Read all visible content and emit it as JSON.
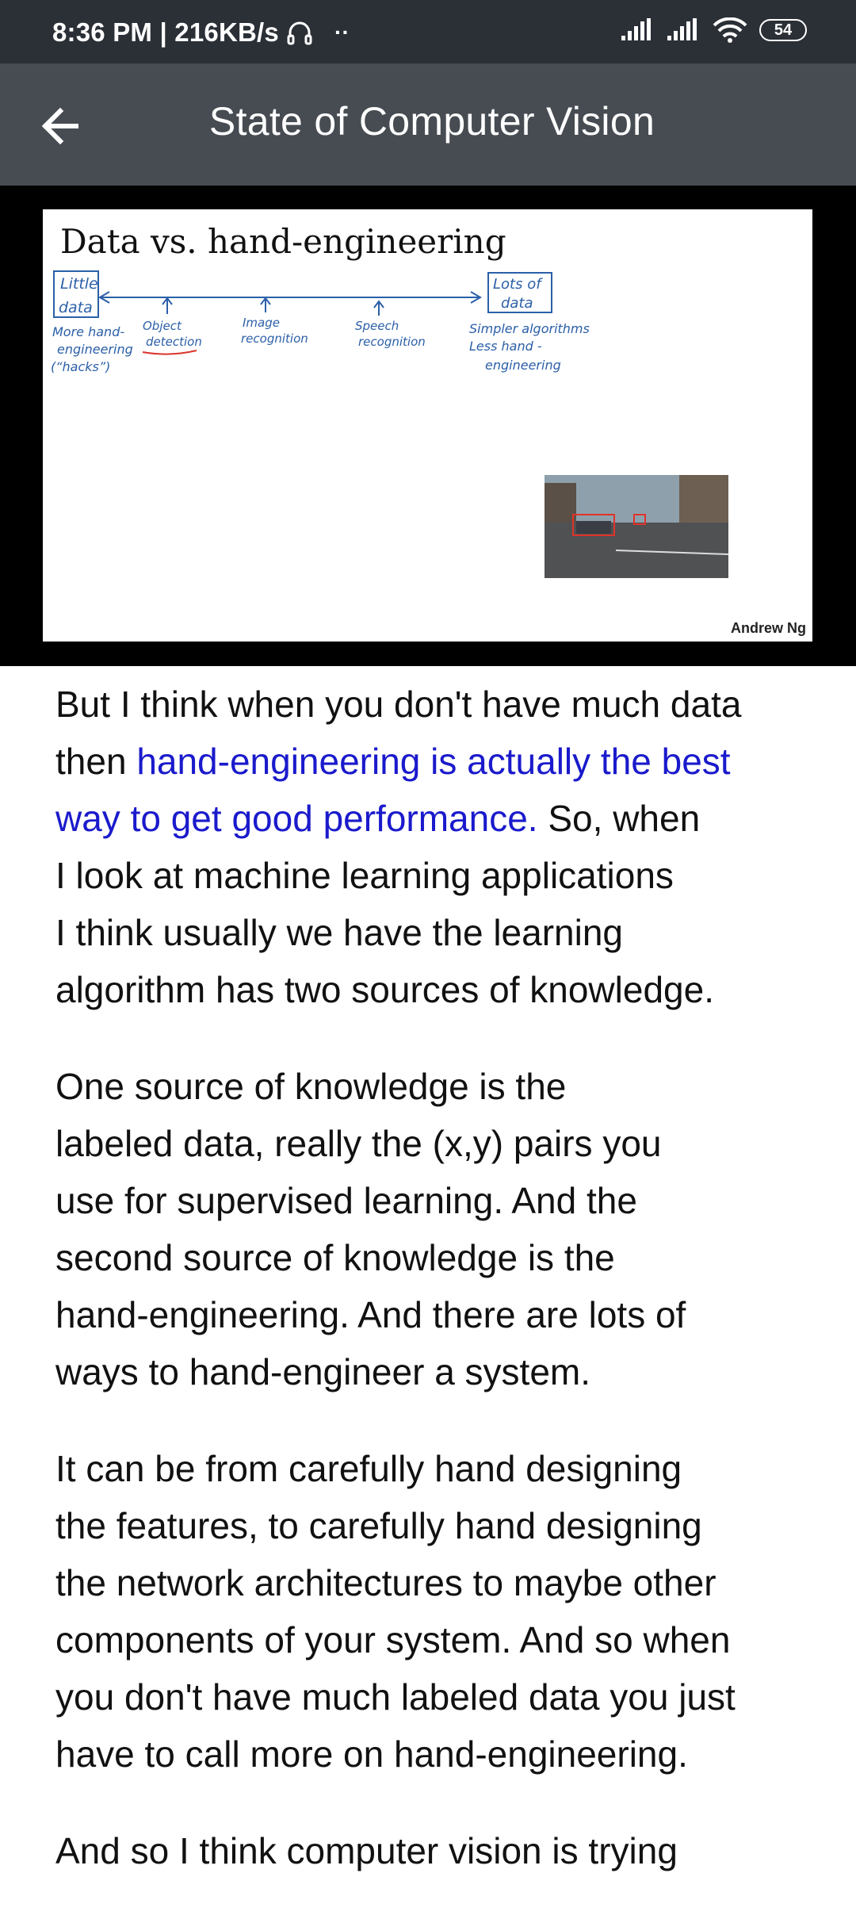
{
  "status": {
    "time_speed": "8:36 PM | 216KB/s",
    "battery": "54"
  },
  "app_bar": {
    "title": "State of Computer Vision"
  },
  "slide": {
    "title": "Data vs. hand-engineering",
    "left_box": [
      "Little",
      "data"
    ],
    "left_notes": [
      "More hand-",
      "engineering",
      "(“hacks”)"
    ],
    "right_box": [
      "Lots of",
      "data"
    ],
    "right_notes": [
      "Simpler algorithms",
      "Less hand -",
      "engineering"
    ],
    "markers": [
      [
        "Object",
        "detection"
      ],
      [
        "Image",
        "recognition"
      ],
      [
        "Speech",
        "recognition"
      ]
    ],
    "credit": "Andrew Ng"
  },
  "transcript": {
    "p1_pre": "But I think when you don't have much data then ",
    "p1_highlight": "hand-engineering is actually the best way to get good performance.",
    "p1_post": " So, when I look at machine learning applications I think usually we have the learning algorithm has two sources of knowledge.",
    "p1_l1": "But I think when you don't have much data",
    "p1_l2a": "then ",
    "p1_l2b": "hand-engineering is actually the best",
    "p1_l3a": "way to get good performance.",
    "p1_l3b": " So, when",
    "p1_l4": "I look at machine learning applications",
    "p1_l5": "I think usually we have the learning",
    "p1_l6": "algorithm has two sources of knowledge.",
    "p2_l1": "One source of knowledge is the",
    "p2_l2": "labeled data, really the (x,y) pairs you",
    "p2_l3": "use for supervised learning. And the",
    "p2_l4": "second source of knowledge is the",
    "p2_l5": "hand-engineering. And there are lots of",
    "p2_l6": "ways to hand-engineer a system.",
    "p3_l1": "It can be from carefully hand designing",
    "p3_l2": "the features, to carefully hand designing",
    "p3_l3": "the network architectures to maybe other",
    "p3_l4": "components of your system. And so when",
    "p3_l5": "you don't have much labeled data you just",
    "p3_l6": "have to call more on hand-engineering.",
    "p4_l1": "And so I think computer vision is trying"
  }
}
